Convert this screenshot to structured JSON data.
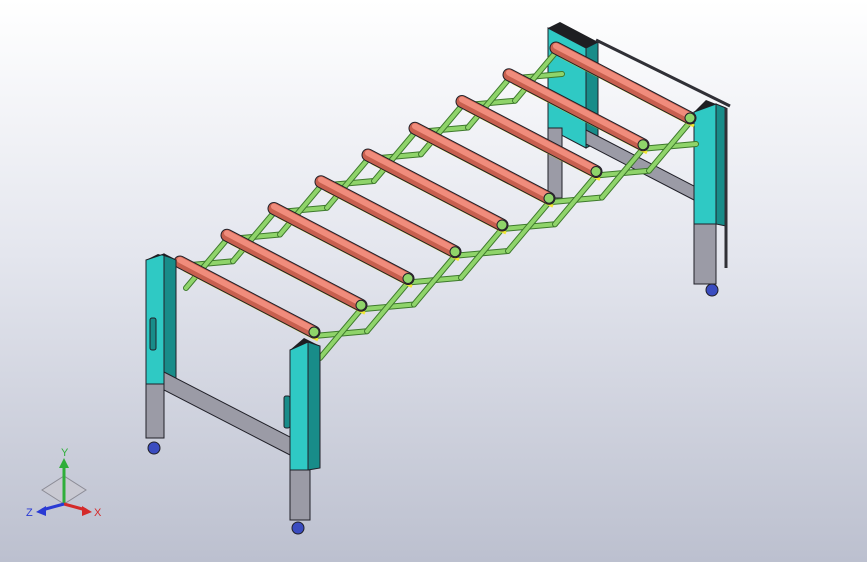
{
  "triad": {
    "x_label": "X",
    "y_label": "Y",
    "z_label": "Z"
  },
  "colors": {
    "roller": "#f08c7c",
    "roller_shade": "#c8604f",
    "scissor_link": "#8fd46a",
    "scissor_edge": "#3e7a2c",
    "side_bar": "#f2e632",
    "upright": "#2fc9c4",
    "upright_dark": "#188c89",
    "leg": "#9b9ba6",
    "caster": "#3a4cc0",
    "edge": "#202028"
  }
}
